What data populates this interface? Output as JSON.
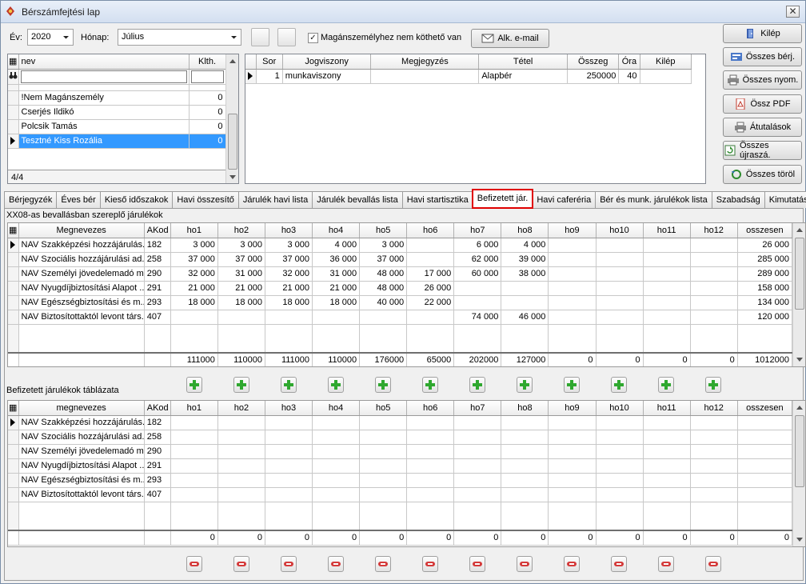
{
  "window": {
    "title": "Bérszámfejtési lap"
  },
  "filters": {
    "year_label": "Év:",
    "year_value": "2020",
    "month_label": "Hónap:",
    "month_value": "Július",
    "checkbox_label": "Magánszemélyhez nem köthető van",
    "checkbox_checked": true,
    "email_button": "Alk. e-mail"
  },
  "people_grid": {
    "col_name": "nev",
    "col_klth": "Klth.",
    "rows": [
      {
        "name": "!Nem Magánszemély",
        "klth": "0"
      },
      {
        "name": "Cserjés Ildikó",
        "klth": "0"
      },
      {
        "name": "Polcsik Tamás",
        "klth": "0"
      },
      {
        "name": "Tesztné Kiss Rozália",
        "klth": "0"
      }
    ],
    "selected_index": 3,
    "counter": "4/4"
  },
  "jobs_grid": {
    "headers": [
      "Sor",
      "Jogviszony",
      "Megjegyzés",
      "Tétel",
      "Összeg",
      "Óra",
      "Kilép"
    ],
    "rows": [
      {
        "sor": "1",
        "jogviszony": "munkaviszony",
        "megjegyzes": "",
        "tetel": "Alapbér",
        "osszeg": "250000",
        "ora": "40",
        "kilep": ""
      }
    ]
  },
  "actions": {
    "exit": "Kilép",
    "all_payslips": "Összes bérj.",
    "print_all": "Összes nyom.",
    "all_pdf": "Össz PDF",
    "transfers": "Átutalások",
    "recalc_all": "Összes újraszá.",
    "delete_all": "Összes töröl"
  },
  "tabs": [
    {
      "label": "Bérjegyzék",
      "active": false
    },
    {
      "label": "Éves bér",
      "active": false
    },
    {
      "label": "Kieső időszakok",
      "active": false
    },
    {
      "label": "Havi összesítő",
      "active": false
    },
    {
      "label": "Járulék havi lista",
      "active": false
    },
    {
      "label": "Járulék bevallás lista",
      "active": false
    },
    {
      "label": "Havi startisztika",
      "active": false
    },
    {
      "label": "Befizetett jár.",
      "active": true
    },
    {
      "label": "Havi caferéria",
      "active": false
    },
    {
      "label": "Bér és munk. járulékok lista",
      "active": false
    },
    {
      "label": "Szabadság",
      "active": false
    },
    {
      "label": "Kimutatás",
      "active": false
    }
  ],
  "section1": {
    "caption": "XX08-as bevallásban szereplő járulékok",
    "headers": [
      "Megnevezes",
      "AKod",
      "ho1",
      "ho2",
      "ho3",
      "ho4",
      "ho5",
      "ho6",
      "ho7",
      "ho8",
      "ho9",
      "ho10",
      "ho11",
      "ho12",
      "osszesen"
    ],
    "rows": [
      {
        "name": "NAV Szakképzési hozzájárulás...",
        "akod": "182",
        "months": [
          "3 000",
          "3 000",
          "3 000",
          "4 000",
          "3 000",
          "",
          "6 000",
          "4 000",
          "",
          "",
          "",
          ""
        ],
        "total": "26 000"
      },
      {
        "name": "NAV Szociális hozzájárulási ad...",
        "akod": "258",
        "months": [
          "37 000",
          "37 000",
          "37 000",
          "36 000",
          "37 000",
          "",
          "62 000",
          "39 000",
          "",
          "",
          "",
          ""
        ],
        "total": "285 000"
      },
      {
        "name": "NAV Személyi jövedelemadó m...",
        "akod": "290",
        "months": [
          "32 000",
          "31 000",
          "32 000",
          "31 000",
          "48 000",
          "17 000",
          "60 000",
          "38 000",
          "",
          "",
          "",
          ""
        ],
        "total": "289 000"
      },
      {
        "name": "NAV Nyugdíjbiztosítási Alapot ...",
        "akod": "291",
        "months": [
          "21 000",
          "21 000",
          "21 000",
          "21 000",
          "48 000",
          "26 000",
          "",
          "",
          "",
          "",
          "",
          ""
        ],
        "total": "158 000"
      },
      {
        "name": "NAV Egészségbiztosítási és m...",
        "akod": "293",
        "months": [
          "18 000",
          "18 000",
          "18 000",
          "18 000",
          "40 000",
          "22 000",
          "",
          "",
          "",
          "",
          "",
          ""
        ],
        "total": "134 000"
      },
      {
        "name": "NAV Biztosítottaktól levont társ...",
        "akod": "407",
        "months": [
          "",
          "",
          "",
          "",
          "",
          "",
          "74 000",
          "46 000",
          "",
          "",
          "",
          ""
        ],
        "total": "120 000"
      }
    ],
    "totals": [
      "111000",
      "110000",
      "111000",
      "110000",
      "176000",
      "65000",
      "202000",
      "127000",
      "0",
      "0",
      "0",
      "0",
      "1012000"
    ]
  },
  "section2": {
    "caption": "Befizetett járulékok táblázata",
    "headers": [
      "megnevezes",
      "AKod",
      "ho1",
      "ho2",
      "ho3",
      "ho4",
      "ho5",
      "ho6",
      "ho7",
      "ho8",
      "ho9",
      "ho10",
      "ho11",
      "ho12",
      "osszesen"
    ],
    "rows": [
      {
        "name": "NAV Szakképzési hozzájárulás...",
        "akod": "182"
      },
      {
        "name": "NAV Szociális hozzájárulási ad...",
        "akod": "258"
      },
      {
        "name": "NAV Személyi jövedelemadó m...",
        "akod": "290"
      },
      {
        "name": "NAV Nyugdíjbiztosítási Alapot ...",
        "akod": "291"
      },
      {
        "name": "NAV Egészségbiztosítási és m...",
        "akod": "293"
      },
      {
        "name": "NAV Biztosítottaktól levont társ...",
        "akod": "407"
      }
    ],
    "totals": [
      "0",
      "0",
      "0",
      "0",
      "0",
      "0",
      "0",
      "0",
      "0",
      "0",
      "0",
      "0",
      "0"
    ]
  },
  "colors": {
    "selection": "#3399ff",
    "tab_highlight": "#e00000",
    "plus": "#2fa82f",
    "minus": "#d43a3a"
  }
}
